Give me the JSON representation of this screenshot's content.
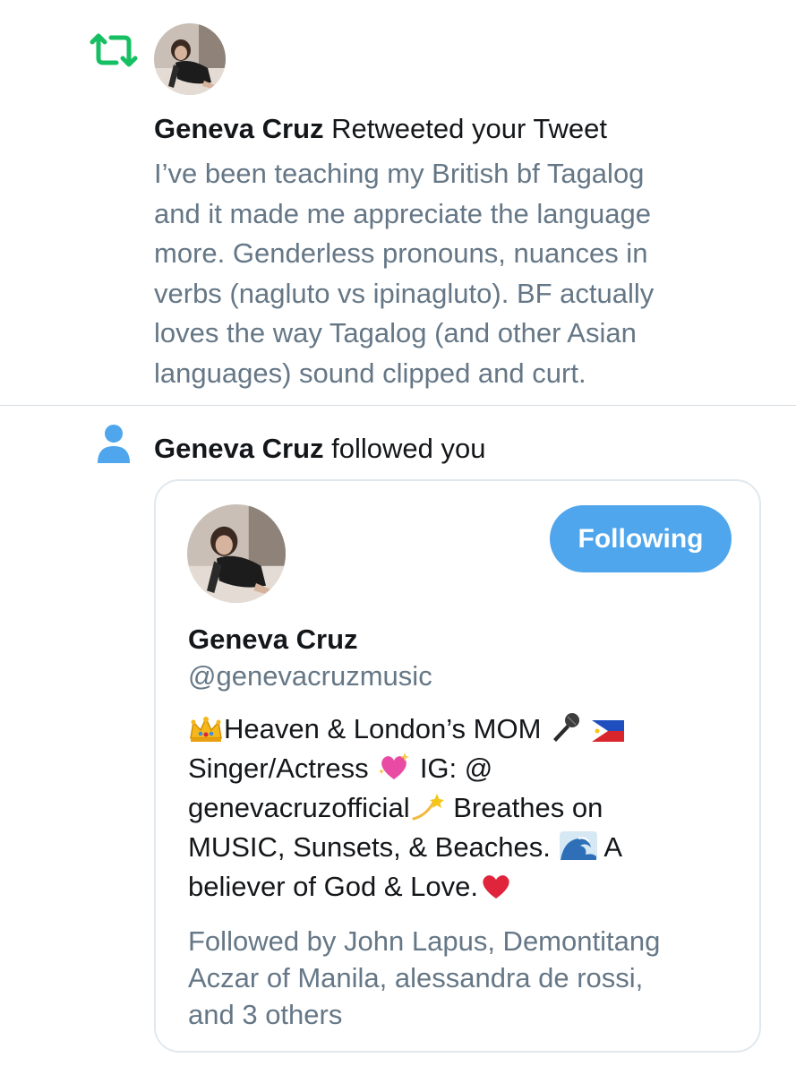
{
  "colors": {
    "retweet_green": "#17bf63",
    "follow_blue": "#4fa6ec",
    "secondary_text": "#657786",
    "primary_text": "#14171a"
  },
  "retweet_notification": {
    "icon": "retweet-icon",
    "user_name": "Geneva Cruz",
    "action_text": "Retweeted your Tweet",
    "tweet_lines": [
      "I’ve been teaching my British bf Tagalog",
      "and it made me appreciate the language",
      "more. Genderless pronouns, nuances in",
      "verbs (nagluto vs ipinagluto). BF actually",
      "loves the way Tagalog (and other Asian",
      "languages) sound clipped and curt."
    ]
  },
  "follow_notification": {
    "icon": "person-icon",
    "user_name": "Geneva Cruz",
    "action_text": "followed you",
    "card": {
      "button_label": "Following",
      "name": "Geneva Cruz",
      "handle": "@genevacruzmusic",
      "bio_lines": [
        {
          "pre": "",
          "icon1": "crown-emoji",
          "mid": "Heaven & London’s MOM ",
          "icon2": "microphone-emoji",
          "post": " ",
          "icon3": "philippines-flag-emoji",
          "tail": ""
        },
        {
          "pre": "Singer/Actress ",
          "icon1": "sparkling-heart-emoji",
          "mid": " IG: @",
          "icon2": "",
          "post": "",
          "icon3": "",
          "tail": ""
        },
        {
          "pre": "genevacruzofficial",
          "icon1": "dizzy-emoji",
          "mid": " Breathes on",
          "icon2": "",
          "post": "",
          "icon3": "",
          "tail": ""
        },
        {
          "pre": "MUSIC, Sunsets, & Beaches. ",
          "icon1": "wave-emoji",
          "mid": " A",
          "icon2": "",
          "post": "",
          "icon3": "",
          "tail": ""
        },
        {
          "pre": "believer of God & Love.",
          "icon1": "red-heart-emoji",
          "mid": "",
          "icon2": "",
          "post": "",
          "icon3": "",
          "tail": ""
        }
      ],
      "followed_by_lines": [
        "Followed by John Lapus, Demontitang",
        "Aczar of Manila, alessandra de rossi,",
        "and 3 others"
      ]
    }
  }
}
